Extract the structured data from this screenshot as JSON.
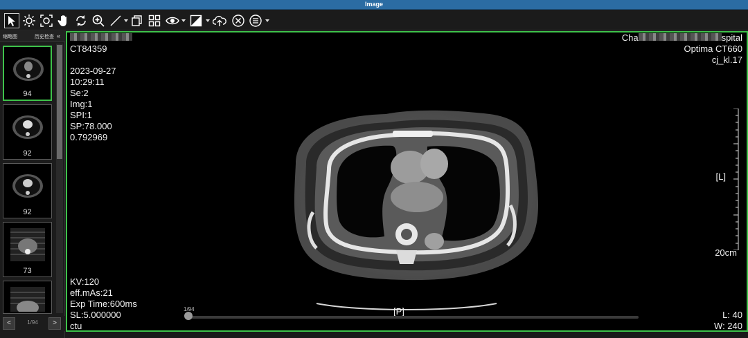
{
  "window": {
    "title": "Image"
  },
  "toolbar": {
    "tools": [
      "select-arrow-icon",
      "brightness-icon",
      "zoom-fit-icon",
      "pan-hand-icon",
      "rotate-icon",
      "zoom-icon",
      "measure-line-icon",
      "copy-icon",
      "layout-grid-icon",
      "eye-icon",
      "invert-icon",
      "cloud-upload-icon",
      "close-circle-icon",
      "menu-list-icon"
    ]
  },
  "sidebar": {
    "tab1": "缩略图",
    "tab2": "历史检查",
    "collapse": "«",
    "thumbnails": [
      {
        "count": "94"
      },
      {
        "count": "92"
      },
      {
        "count": "92"
      },
      {
        "count": "73"
      },
      {
        "count": ""
      }
    ],
    "pager": {
      "prev": "<",
      "label": "1/94",
      "next": ">"
    }
  },
  "viewer": {
    "top_left": {
      "patient_id": "CT84359",
      "date": "2023-09-27",
      "time": "10:29:11",
      "series": "Se:2",
      "image": "Img:1",
      "spi": "SPI:1",
      "sp": "SP:78.000",
      "ratio": "0.792969"
    },
    "top_right": {
      "hospital_prefix": "Cha",
      "hospital_suffix": "spital",
      "scanner": "Optima CT660",
      "kernel": "cj_kl.17"
    },
    "orientation_right": "[L]",
    "orientation_bottom": "[P]",
    "scale": "20cm",
    "bottom_left": {
      "kv": "KV:120",
      "mas": "eff.mAs:21",
      "exp": "Exp Time:600ms",
      "sl": "SL:5.000000",
      "unit": "ctu"
    },
    "bottom_right": {
      "level": "L: 40",
      "width": "W: 240"
    },
    "slider": {
      "label": "1/94",
      "position": 0.0
    }
  },
  "colors": {
    "active_border": "#3ec24a",
    "titlebar": "#2b6ca3"
  }
}
